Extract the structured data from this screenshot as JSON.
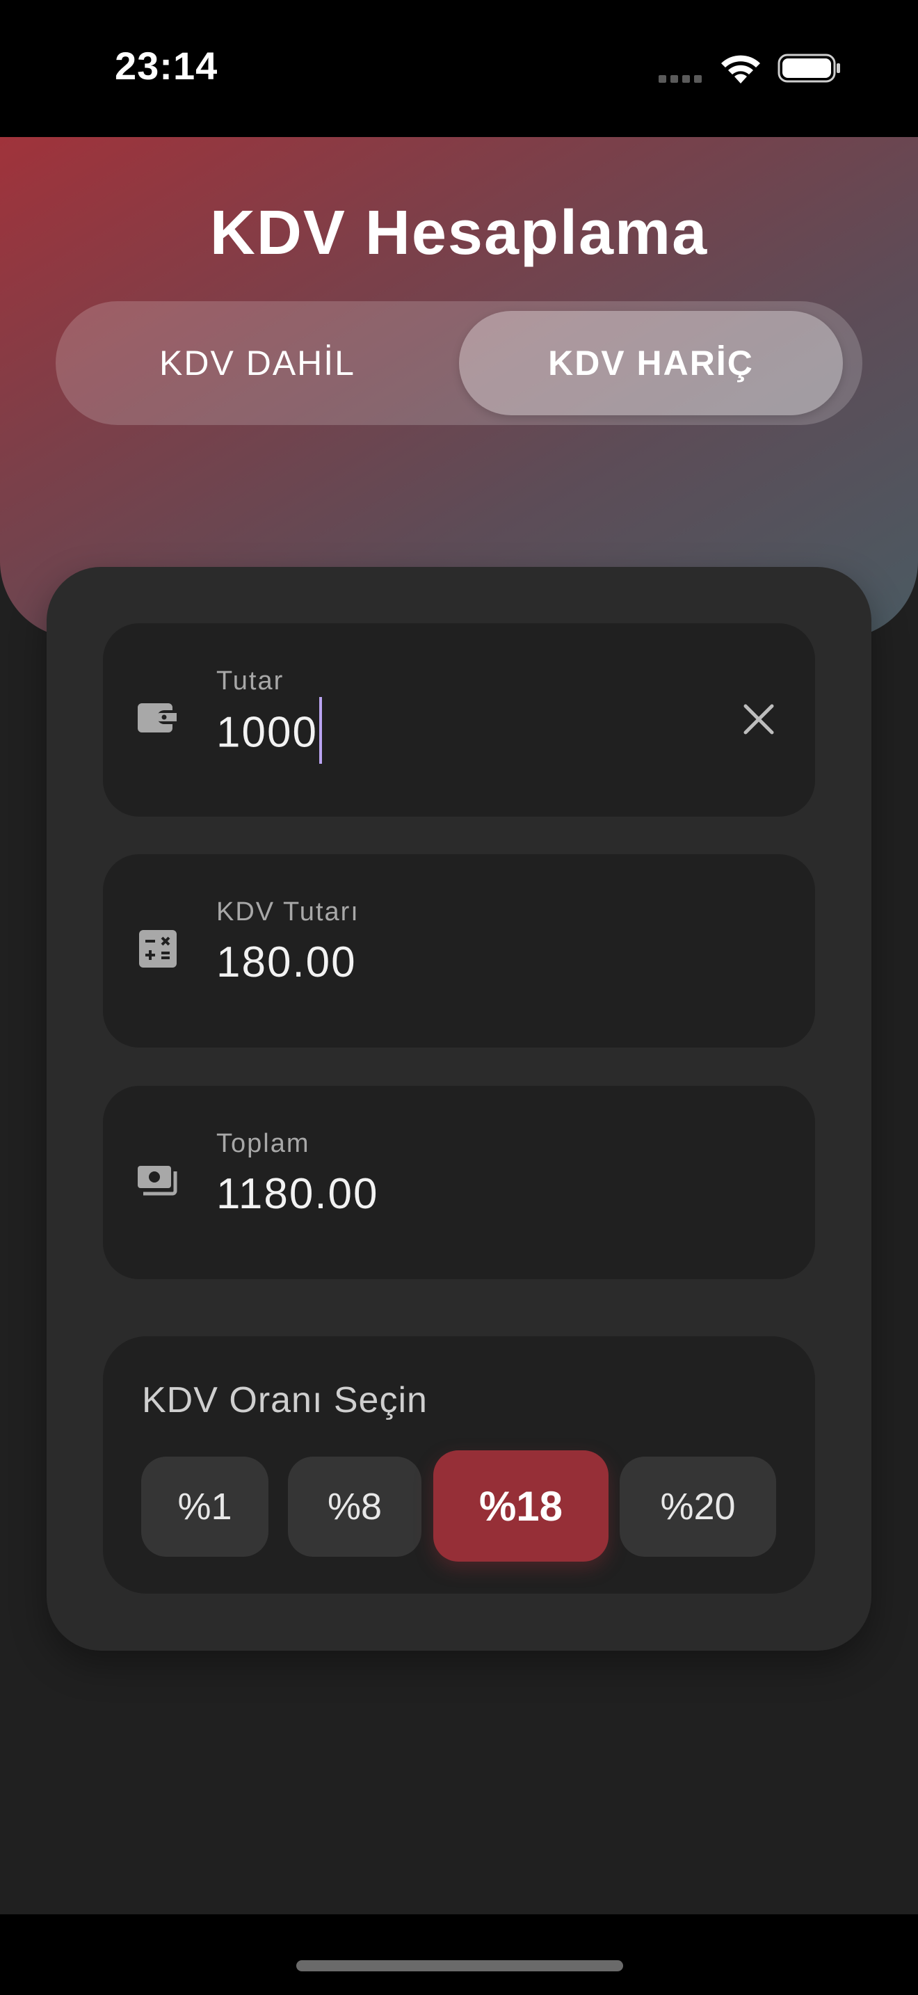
{
  "status_bar": {
    "time": "23:14"
  },
  "header": {
    "title": "KDV Hesaplama",
    "segment_options": [
      "KDV DAHİL",
      "KDV HARİÇ"
    ],
    "selected_option": "KDV HARİÇ"
  },
  "fields": {
    "amount": {
      "label": "Tutar",
      "value": "1000",
      "icon": "wallet-icon"
    },
    "vat_amount": {
      "label": "KDV Tutarı",
      "value": "180.00",
      "icon": "calculator-icon"
    },
    "total": {
      "label": "Toplam",
      "value": "1180.00",
      "icon": "cash-icon"
    }
  },
  "rates": {
    "label": "KDV Oranı Seçin",
    "options": [
      "%1",
      "%8",
      "%18",
      "%20"
    ],
    "selected": "%18"
  },
  "colors": {
    "accent": "#962f37",
    "caret": "#b9a3f0",
    "card": "#2b2b2b",
    "background": "#202020"
  }
}
